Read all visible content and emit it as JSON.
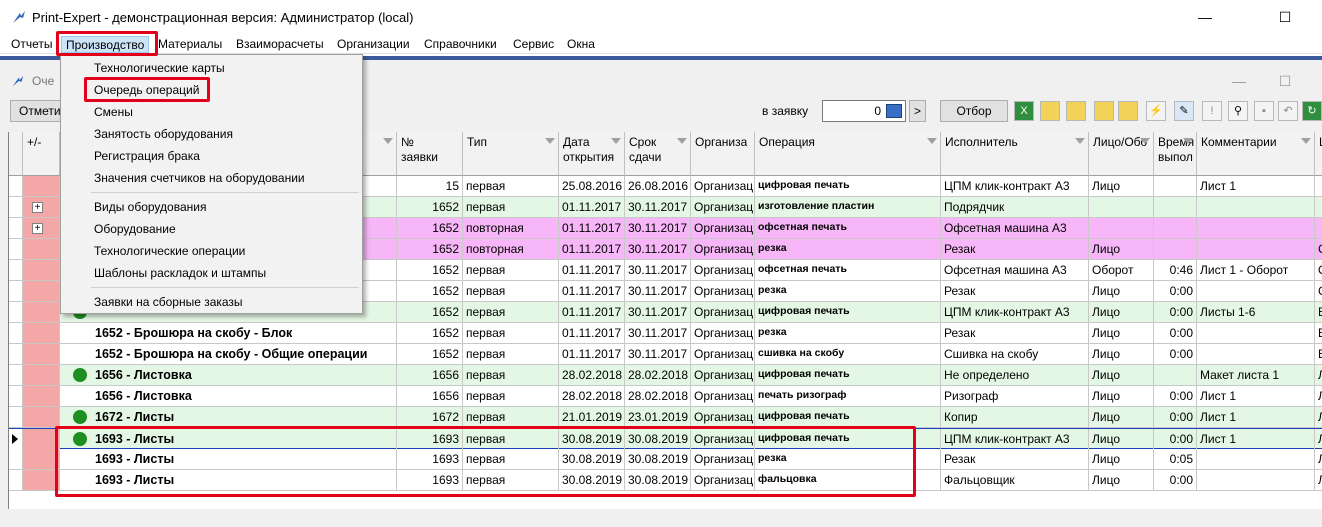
{
  "window": {
    "title": "Print-Expert - демонстрационная версия: Администратор (local)",
    "controls": [
      "—",
      "☐",
      "✕"
    ]
  },
  "menubar": {
    "items": [
      "Отчеты",
      "Производство",
      "Материалы",
      "Взаиморасчеты",
      "Организации",
      "Справочники",
      "Сервис",
      "Окна"
    ]
  },
  "dropdown": {
    "items": [
      "Технологические карты",
      "Очередь операций",
      "Смены",
      "Занятость оборудования",
      "Регистрация брака",
      "Значения счетчиков на оборудовании",
      "Виды оборудования",
      "Оборудование",
      "Технологические операции",
      "Шаблоны раскладок и штампы",
      "Заявки на сборные заказы"
    ]
  },
  "mdi": {
    "title": "Оче",
    "controls": [
      "—",
      "☐"
    ]
  },
  "toolbar": {
    "mark_label": "Отмети",
    "order_label": "в заявку",
    "order_value": "0",
    "go_label": ">",
    "filter_label": "Отбор"
  },
  "grid": {
    "headers": {
      "pm": "+/-",
      "order_no": "№\nзаявки",
      "type": "Тип",
      "open_date": "Дата\nоткрытия",
      "due_date": "Срок\nсдачи",
      "org": "Организа",
      "operation": "Операция",
      "executor": "Исполнитель",
      "side": "Лицо/Обо",
      "time": "Время\nвыпол",
      "comment": "Комментарии",
      "last": "Ш"
    },
    "rows": [
      {
        "name": "",
        "no": "15",
        "type": "первая",
        "open": "25.08.2016",
        "due": "26.08.2016",
        "org": "Организац",
        "op": "цифровая печать",
        "exec": "ЦПМ клик-контракт А3",
        "side": "Лицо",
        "time": "",
        "comment": "Лист 1",
        "last": "",
        "bg": "#ffffff",
        "dot": false,
        "exp": false
      },
      {
        "name": "",
        "no": "1652",
        "type": "первая",
        "open": "01.11.2017",
        "due": "30.11.2017",
        "org": "Организац",
        "op": "изготовление пластин",
        "exec": "Подрядчик",
        "side": "",
        "time": "",
        "comment": "",
        "last": "",
        "bg": "#e4f7e4",
        "dot": false,
        "exp": true
      },
      {
        "name": "",
        "no": "1652",
        "type": "повторная",
        "open": "01.11.2017",
        "due": "30.11.2017",
        "org": "Организац",
        "op": "офсетная печать",
        "exec": "Офсетная машина А3",
        "side": "",
        "time": "",
        "comment": "",
        "last": "",
        "bg": "#f7b6f7",
        "dot": false,
        "exp": true
      },
      {
        "name": "",
        "no": "1652",
        "type": "повторная",
        "open": "01.11.2017",
        "due": "30.11.2017",
        "org": "Организац",
        "op": "резка",
        "exec": "Резак",
        "side": "Лицо",
        "time": "",
        "comment": "",
        "last": "С",
        "bg": "#f7b6f7",
        "dot": false,
        "exp": false
      },
      {
        "name": "",
        "no": "1652",
        "type": "первая",
        "open": "01.11.2017",
        "due": "30.11.2017",
        "org": "Организац",
        "op": "офсетная печать",
        "exec": "Офсетная машина А3",
        "side": "Оборот",
        "time": "0:46",
        "comment": "Лист 1 - Оборот",
        "last": "О",
        "bg": "#ffffff",
        "dot": false,
        "exp": false
      },
      {
        "name": "",
        "no": "1652",
        "type": "первая",
        "open": "01.11.2017",
        "due": "30.11.2017",
        "org": "Организац",
        "op": "резка",
        "exec": "Резак",
        "side": "Лицо",
        "time": "0:00",
        "comment": "",
        "last": "С",
        "bg": "#ffffff",
        "dot": false,
        "exp": false
      },
      {
        "name": "",
        "no": "1652",
        "type": "первая",
        "open": "01.11.2017",
        "due": "30.11.2017",
        "org": "Организац",
        "op": "цифровая печать",
        "exec": "ЦПМ клик-контракт А3",
        "side": "Лицо",
        "time": "0:00",
        "comment": "Листы 1-6",
        "last": "Б",
        "bg": "#e4f7e4",
        "dot": true,
        "exp": false
      },
      {
        "name": "1652 - Брошюра на скобу - Блок",
        "no": "1652",
        "type": "первая",
        "open": "01.11.2017",
        "due": "30.11.2017",
        "org": "Организац",
        "op": "резка",
        "exec": "Резак",
        "side": "Лицо",
        "time": "0:00",
        "comment": "",
        "last": "Б",
        "bg": "#ffffff",
        "dot": false,
        "exp": false
      },
      {
        "name": "1652 - Брошюра на скобу - Общие операции",
        "no": "1652",
        "type": "первая",
        "open": "01.11.2017",
        "due": "30.11.2017",
        "org": "Организац",
        "op": "сшивка на скобу",
        "exec": "Сшивка на скобу",
        "side": "Лицо",
        "time": "0:00",
        "comment": "",
        "last": "Б",
        "bg": "#ffffff",
        "dot": false,
        "exp": false
      },
      {
        "name": "1656 - Листовка",
        "no": "1656",
        "type": "первая",
        "open": "28.02.2018",
        "due": "28.02.2018",
        "org": "Организац",
        "op": "цифровая печать",
        "exec": "Не определено",
        "side": "Лицо",
        "time": "",
        "comment": "Макет листа 1",
        "last": "Л",
        "bg": "#e4f7e4",
        "dot": true,
        "exp": false
      },
      {
        "name": "1656 - Листовка",
        "no": "1656",
        "type": "первая",
        "open": "28.02.2018",
        "due": "28.02.2018",
        "org": "Организац",
        "op": "печать ризограф",
        "exec": "Ризограф",
        "side": "Лицо",
        "time": "0:00",
        "comment": "Лист 1",
        "last": "Л",
        "bg": "#ffffff",
        "dot": false,
        "exp": false
      },
      {
        "name": "1672 - Листы",
        "no": "1672",
        "type": "первая",
        "open": "21.01.2019",
        "due": "23.01.2019",
        "org": "Организац",
        "op": "цифровая печать",
        "exec": "Копир",
        "side": "Лицо",
        "time": "0:00",
        "comment": "Лист 1",
        "last": "Л",
        "bg": "#e4f7e4",
        "dot": true,
        "exp": false
      },
      {
        "name": "1693 - Листы",
        "no": "1693",
        "type": "первая",
        "open": "30.08.2019",
        "due": "30.08.2019",
        "org": "Организац",
        "op": "цифровая печать",
        "exec": "ЦПМ клик-контракт А3",
        "side": "Лицо",
        "time": "0:00",
        "comment": "Лист 1",
        "last": "Л",
        "bg": "#e4f7e4",
        "dot": true,
        "exp": false,
        "current": true
      },
      {
        "name": "1693 - Листы",
        "no": "1693",
        "type": "первая",
        "open": "30.08.2019",
        "due": "30.08.2019",
        "org": "Организац",
        "op": "резка",
        "exec": "Резак",
        "side": "Лицо",
        "time": "0:05",
        "comment": "",
        "last": "Л",
        "bg": "#ffffff",
        "dot": false,
        "exp": false
      },
      {
        "name": "1693 - Листы",
        "no": "1693",
        "type": "первая",
        "open": "30.08.2019",
        "due": "30.08.2019",
        "org": "Организац",
        "op": "фальцовка",
        "exec": "Фальцовщик",
        "side": "Лицо",
        "time": "0:00",
        "comment": "",
        "last": "Л",
        "bg": "#ffffff",
        "dot": false,
        "exp": false
      }
    ]
  },
  "colors": {
    "highlight_red": "#e3001b",
    "green_row": "#e4f7e4",
    "pink_row": "#f7b6f7",
    "pm_column": "#f4a7a7",
    "status_dot": "#1e8e1e"
  }
}
